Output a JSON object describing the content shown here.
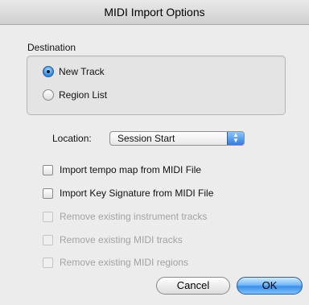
{
  "window": {
    "title": "MIDI Import Options"
  },
  "destination": {
    "label": "Destination",
    "options": [
      {
        "label": "New Track",
        "selected": true
      },
      {
        "label": "Region List",
        "selected": false
      }
    ]
  },
  "location": {
    "label": "Location:",
    "selected": "Session Start",
    "arrows_icon": "up-down-arrows-icon"
  },
  "checkboxes": [
    {
      "label": "Import tempo map from MIDI File",
      "checked": false,
      "enabled": true
    },
    {
      "label": "Import Key Signature from MIDI File",
      "checked": false,
      "enabled": true
    },
    {
      "label": "Remove existing instrument tracks",
      "checked": false,
      "enabled": false
    },
    {
      "label": "Remove existing MIDI tracks",
      "checked": false,
      "enabled": false
    },
    {
      "label": "Remove existing MIDI regions",
      "checked": false,
      "enabled": false
    }
  ],
  "buttons": {
    "cancel": "Cancel",
    "ok": "OK"
  },
  "colors": {
    "accent": "#3b8fe0",
    "window_bg": "#ececec",
    "disabled_text": "#a3a3a3"
  }
}
